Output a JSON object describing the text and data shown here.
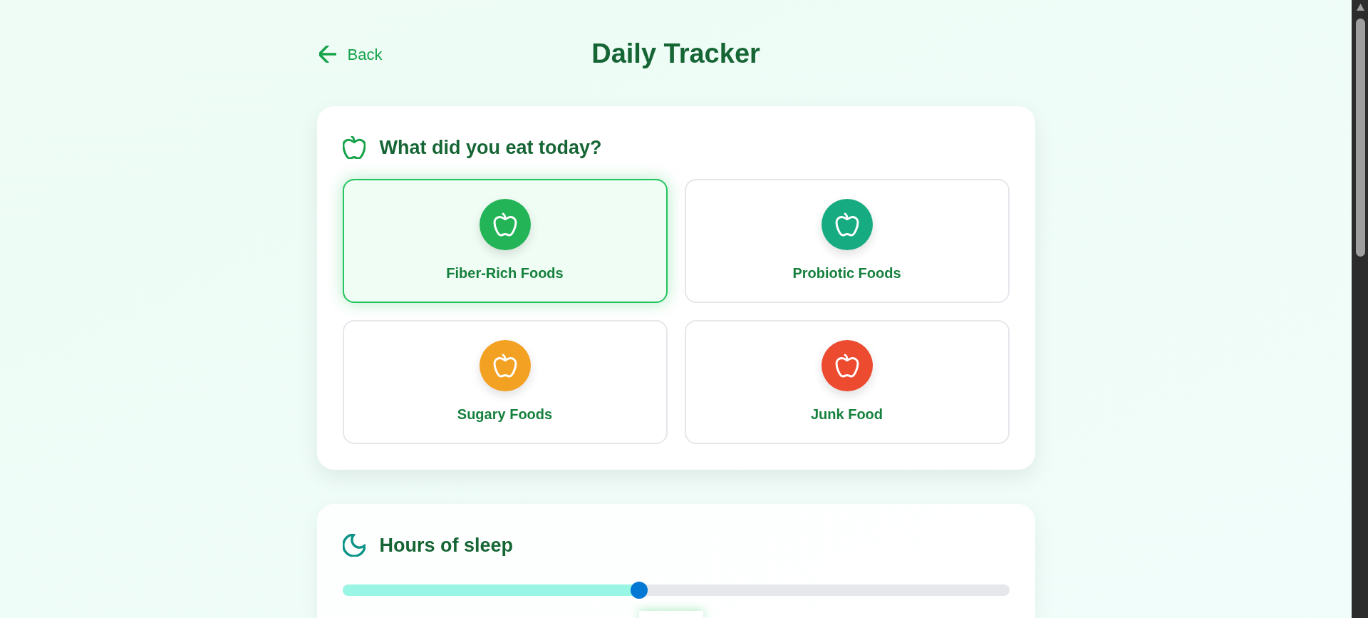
{
  "header": {
    "back_link": "Back",
    "title": "Daily Tracker"
  },
  "food_section": {
    "heading": "What did you eat today?",
    "options": [
      {
        "label": "Fiber-Rich Foods",
        "color": "#22b457",
        "selected": true
      },
      {
        "label": "Probiotic Foods",
        "color": "#17ab82",
        "selected": false
      },
      {
        "label": "Sugary Foods",
        "color": "#f3a122",
        "selected": false
      },
      {
        "label": "Junk Food",
        "color": "#ec4b30",
        "selected": false
      }
    ]
  },
  "sleep_section": {
    "heading": "Hours of sleep",
    "slider": {
      "level": 0.445
    }
  }
}
